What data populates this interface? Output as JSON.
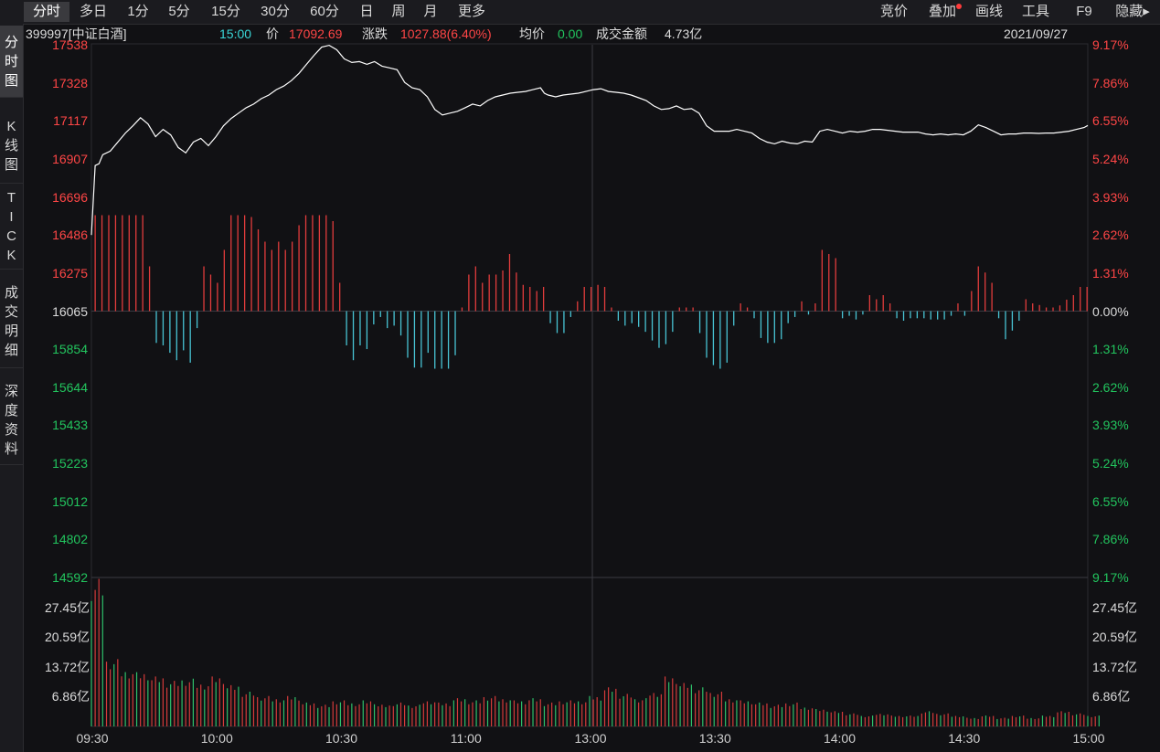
{
  "tabs": [
    {
      "label": "分时",
      "active": true
    },
    {
      "label": "多日",
      "active": false
    },
    {
      "label": "1分",
      "active": false
    },
    {
      "label": "5分",
      "active": false
    },
    {
      "label": "15分",
      "active": false
    },
    {
      "label": "30分",
      "active": false
    },
    {
      "label": "60分",
      "active": false
    },
    {
      "label": "日",
      "active": false
    },
    {
      "label": "周",
      "active": false
    },
    {
      "label": "月",
      "active": false
    },
    {
      "label": "更多",
      "active": false
    }
  ],
  "right_tools": [
    "竞价",
    "叠加",
    "画线",
    "工具",
    "F9",
    "隐藏▸"
  ],
  "sidebar": [
    {
      "label": "分时图",
      "active": true
    },
    {
      "label": "K线图",
      "active": false
    },
    {
      "label": "TICK",
      "active": false
    },
    {
      "label": "成交明细",
      "active": false
    },
    {
      "label": "深度资料",
      "active": false
    }
  ],
  "info": {
    "code_name": "399997[中证白酒]",
    "time": "15:00",
    "price_label": "价",
    "price": "17092.69",
    "change_label": "涨跌",
    "change": "1027.88(6.40%)",
    "avg_label": "均价",
    "avg": "0.00",
    "amount_label": "成交金额",
    "amount": "4.73亿",
    "date": "2021/09/27"
  },
  "colors": {
    "up": "#ff4646",
    "down": "#22c55e",
    "volume_down": "#48c4d4",
    "line": "#ffffff",
    "grid": "#2a2a30"
  },
  "chart_data": {
    "type": "line",
    "price_axis": {
      "labels": [
        "17538",
        "17328",
        "17117",
        "16907",
        "16696",
        "16486",
        "16275",
        "16065",
        "15854",
        "15644",
        "15433",
        "15223",
        "15012",
        "14802",
        "14592"
      ],
      "base": 16065,
      "range": [
        14592,
        17538
      ]
    },
    "percent_axis": [
      "9.17%",
      "7.86%",
      "6.55%",
      "5.24%",
      "3.93%",
      "2.62%",
      "1.31%",
      "0.00%",
      "1.31%",
      "2.62%",
      "3.93%",
      "5.24%",
      "6.55%",
      "7.86%",
      "9.17%"
    ],
    "volume_axis": [
      "27.45亿",
      "20.59亿",
      "13.72亿",
      "6.86亿"
    ],
    "volume_range": [
      0,
      34.31
    ],
    "time_axis": [
      "09:30",
      "10:00",
      "10:30",
      "11:00",
      "13:00",
      "13:30",
      "14:00",
      "14:30",
      "15:00"
    ],
    "price_series": [
      [
        0,
        16486
      ],
      [
        1,
        16870
      ],
      [
        2,
        16880
      ],
      [
        3,
        16930
      ],
      [
        5,
        16950
      ],
      [
        7,
        17000
      ],
      [
        9,
        17050
      ],
      [
        11,
        17090
      ],
      [
        13,
        17135
      ],
      [
        15,
        17100
      ],
      [
        17,
        17030
      ],
      [
        19,
        17070
      ],
      [
        21,
        17040
      ],
      [
        23,
        16970
      ],
      [
        25,
        16940
      ],
      [
        27,
        17000
      ],
      [
        29,
        17020
      ],
      [
        31,
        16980
      ],
      [
        33,
        17030
      ],
      [
        35,
        17090
      ],
      [
        37,
        17130
      ],
      [
        39,
        17160
      ],
      [
        41,
        17190
      ],
      [
        43,
        17210
      ],
      [
        45,
        17240
      ],
      [
        47,
        17260
      ],
      [
        49,
        17290
      ],
      [
        51,
        17310
      ],
      [
        53,
        17340
      ],
      [
        55,
        17380
      ],
      [
        57,
        17430
      ],
      [
        59,
        17480
      ],
      [
        61,
        17525
      ],
      [
        63,
        17535
      ],
      [
        65,
        17510
      ],
      [
        67,
        17460
      ],
      [
        69,
        17440
      ],
      [
        71,
        17445
      ],
      [
        73,
        17430
      ],
      [
        75,
        17445
      ],
      [
        77,
        17420
      ],
      [
        79,
        17410
      ],
      [
        81,
        17400
      ],
      [
        83,
        17330
      ],
      [
        85,
        17300
      ],
      [
        87,
        17290
      ],
      [
        89,
        17250
      ],
      [
        91,
        17180
      ],
      [
        93,
        17150
      ],
      [
        95,
        17160
      ],
      [
        97,
        17170
      ],
      [
        99,
        17190
      ],
      [
        101,
        17210
      ],
      [
        103,
        17200
      ],
      [
        105,
        17230
      ],
      [
        107,
        17250
      ],
      [
        109,
        17260
      ],
      [
        111,
        17270
      ],
      [
        113,
        17275
      ],
      [
        115,
        17280
      ],
      [
        117,
        17290
      ],
      [
        119,
        17300
      ],
      [
        120,
        17270
      ],
      [
        121,
        17260
      ],
      [
        123,
        17250
      ],
      [
        125,
        17260
      ],
      [
        127,
        17265
      ],
      [
        129,
        17270
      ],
      [
        131,
        17280
      ],
      [
        133,
        17290
      ],
      [
        135,
        17295
      ],
      [
        137,
        17280
      ],
      [
        139,
        17275
      ],
      [
        141,
        17270
      ],
      [
        143,
        17260
      ],
      [
        145,
        17245
      ],
      [
        147,
        17230
      ],
      [
        149,
        17200
      ],
      [
        151,
        17180
      ],
      [
        153,
        17185
      ],
      [
        155,
        17200
      ],
      [
        157,
        17180
      ],
      [
        159,
        17185
      ],
      [
        161,
        17160
      ],
      [
        163,
        17090
      ],
      [
        165,
        17060
      ],
      [
        167,
        17060
      ],
      [
        169,
        17060
      ],
      [
        171,
        17070
      ],
      [
        173,
        17060
      ],
      [
        175,
        17050
      ],
      [
        177,
        17020
      ],
      [
        179,
        17000
      ],
      [
        181,
        16990
      ],
      [
        183,
        17005
      ],
      [
        185,
        16995
      ],
      [
        187,
        16990
      ],
      [
        189,
        17005
      ],
      [
        191,
        17000
      ],
      [
        193,
        17060
      ],
      [
        195,
        17070
      ],
      [
        197,
        17060
      ],
      [
        199,
        17050
      ],
      [
        201,
        17060
      ],
      [
        203,
        17055
      ],
      [
        205,
        17060
      ],
      [
        207,
        17070
      ],
      [
        209,
        17070
      ],
      [
        211,
        17065
      ],
      [
        213,
        17060
      ],
      [
        215,
        17055
      ],
      [
        217,
        17055
      ],
      [
        219,
        17055
      ],
      [
        221,
        17045
      ],
      [
        223,
        17040
      ],
      [
        225,
        17045
      ],
      [
        227,
        17040
      ],
      [
        229,
        17045
      ],
      [
        231,
        17040
      ],
      [
        233,
        17060
      ],
      [
        235,
        17095
      ],
      [
        237,
        17080
      ],
      [
        239,
        17060
      ],
      [
        241,
        17040
      ],
      [
        243,
        17045
      ],
      [
        245,
        17045
      ],
      [
        247,
        17050
      ],
      [
        249,
        17050
      ],
      [
        251,
        17048
      ],
      [
        253,
        17050
      ],
      [
        255,
        17050
      ],
      [
        257,
        17055
      ],
      [
        259,
        17060
      ],
      [
        261,
        17070
      ],
      [
        263,
        17080
      ],
      [
        264,
        17092
      ]
    ],
    "volume_series": [
      [
        0,
        34.0
      ],
      [
        1,
        15.5
      ],
      [
        2,
        13.0
      ],
      [
        3,
        12.5
      ],
      [
        4,
        11.5
      ],
      [
        5,
        10.5
      ],
      [
        6,
        11.0
      ],
      [
        7,
        10.0
      ],
      [
        8,
        11.5
      ],
      [
        9,
        9.5
      ],
      [
        10,
        8.0
      ],
      [
        11,
        7.0
      ],
      [
        12,
        6.5
      ],
      [
        13,
        7.0
      ],
      [
        14,
        5.5
      ],
      [
        15,
        5.0
      ],
      [
        16,
        6.0
      ],
      [
        17,
        5.5
      ],
      [
        18,
        6.0
      ],
      [
        19,
        5.0
      ],
      [
        20,
        5.5
      ],
      [
        21,
        5.0
      ],
      [
        22,
        6.0
      ],
      [
        23,
        5.5
      ],
      [
        24,
        6.5
      ],
      [
        25,
        6.0
      ],
      [
        26,
        7.0
      ],
      [
        27,
        6.5
      ],
      [
        28,
        6.0
      ],
      [
        29,
        6.5
      ],
      [
        30,
        5.5
      ],
      [
        31,
        6.0
      ],
      [
        32,
        6.0
      ],
      [
        33,
        7.0
      ],
      [
        34,
        9.0
      ],
      [
        35,
        7.5
      ],
      [
        36,
        6.5
      ],
      [
        37,
        8.0
      ],
      [
        38,
        11.5
      ],
      [
        39,
        10.0
      ],
      [
        40,
        9.0
      ],
      [
        41,
        8.0
      ],
      [
        42,
        6.5
      ],
      [
        43,
        6.0
      ],
      [
        44,
        5.5
      ],
      [
        45,
        5.0
      ],
      [
        46,
        5.5
      ],
      [
        47,
        4.5
      ],
      [
        48,
        4.0
      ],
      [
        49,
        3.5
      ],
      [
        50,
        3.0
      ],
      [
        51,
        2.5
      ],
      [
        52,
        3.0
      ],
      [
        53,
        2.5
      ],
      [
        54,
        2.5
      ],
      [
        55,
        3.5
      ],
      [
        56,
        3.0
      ],
      [
        57,
        2.5
      ],
      [
        58,
        2.0
      ],
      [
        59,
        2.5
      ],
      [
        60,
        2.0
      ],
      [
        61,
        2.5
      ],
      [
        62,
        2.0
      ],
      [
        63,
        2.5
      ],
      [
        64,
        3.5
      ],
      [
        65,
        3.0
      ],
      [
        66,
        2.5
      ]
    ]
  }
}
